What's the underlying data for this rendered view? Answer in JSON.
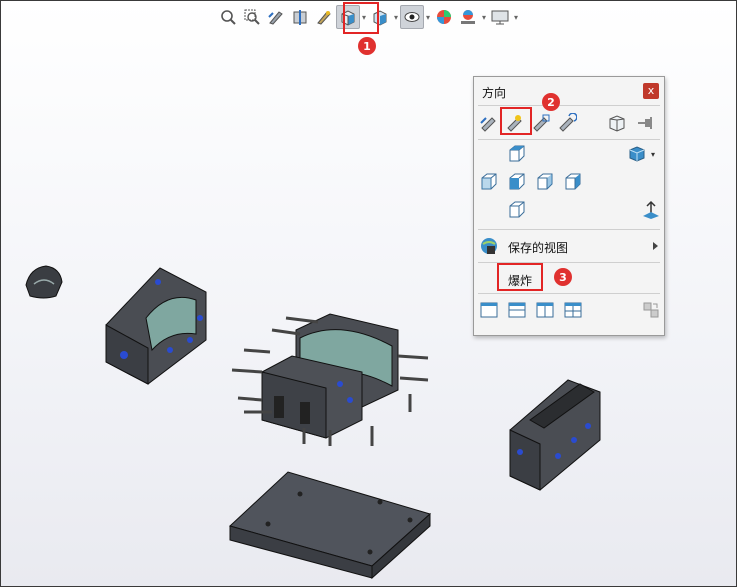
{
  "toolbar": {
    "icons": [
      "zoom-to-fit-icon",
      "zoom-to-area-icon",
      "previous-view-icon",
      "section-view-icon",
      "dynamic-annotation-icon",
      "view-orientation-icon",
      "display-style-icon",
      "hide-show-items-icon",
      "edit-appearance-icon",
      "apply-scene-icon",
      "view-settings-icon"
    ]
  },
  "orientation_panel": {
    "title": "方向",
    "close_label": "x",
    "saved_views_label": "保存的视图",
    "explode_label": "爆炸"
  },
  "annotations": [
    "1",
    "2",
    "3"
  ],
  "colors": {
    "annotation": "#e22525",
    "accent": "#3a8ec9"
  }
}
